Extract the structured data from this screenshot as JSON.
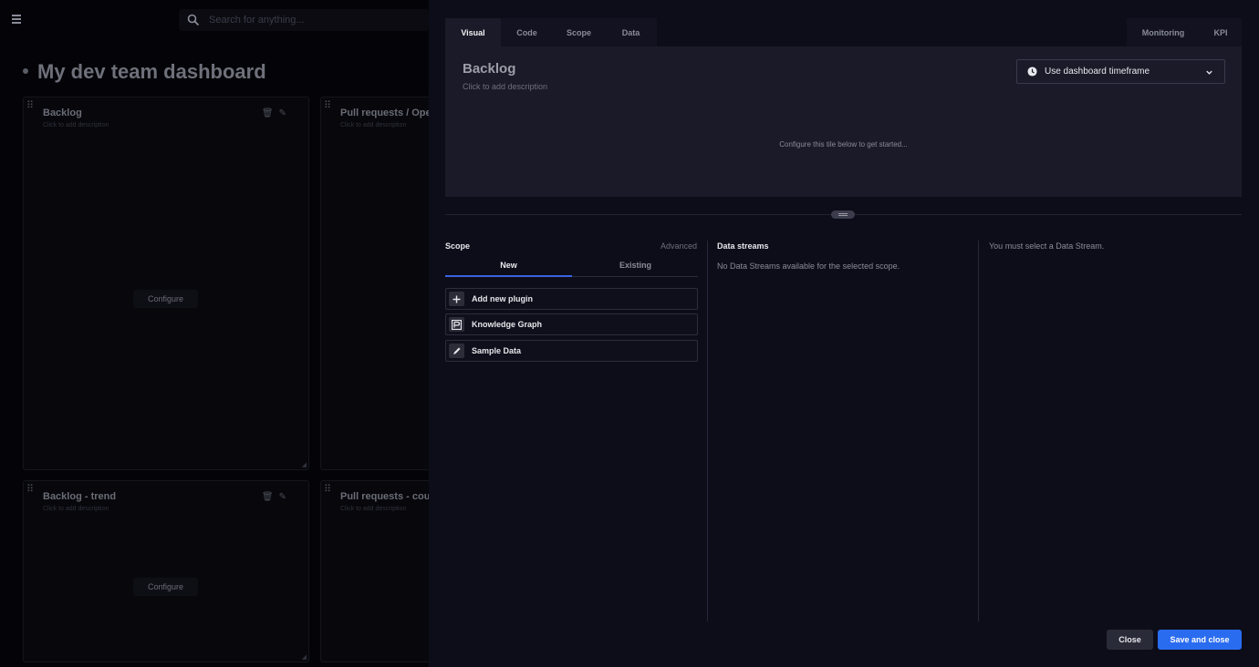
{
  "background": {
    "search_placeholder": "Search for anything...",
    "dashboard_title": "My dev team dashboard",
    "tiles": [
      {
        "title": "Backlog",
        "description": "Click to add description",
        "configure": "Configure"
      },
      {
        "title": "Pull requests / Ope",
        "description": "Click to add description"
      },
      {
        "title": "Backlog - trend",
        "description": "Click to add description",
        "configure": "Configure"
      },
      {
        "title": "Pull requests - cour",
        "description": "Click to add description"
      }
    ]
  },
  "editor": {
    "tabs": [
      "Visual",
      "Code",
      "Scope",
      "Data"
    ],
    "active_tab": "Visual",
    "right_tabs": [
      "Monitoring",
      "KPI"
    ],
    "preview": {
      "title": "Backlog",
      "description": "Click to add description",
      "message": "Configure this tile below to get started..."
    },
    "timeframe": {
      "label": "Use dashboard timeframe"
    },
    "scope": {
      "title": "Scope",
      "advanced": "Advanced",
      "subtabs": [
        "New",
        "Existing"
      ],
      "plugins": [
        {
          "label": "Add new plugin",
          "icon": "plus-icon"
        },
        {
          "label": "Knowledge Graph",
          "icon": "knowledge-graph-icon"
        },
        {
          "label": "Sample Data",
          "icon": "pencil-icon"
        }
      ]
    },
    "data_streams": {
      "title": "Data streams",
      "message": "No Data Streams available for the selected scope."
    },
    "right_message": "You must select a Data Stream.",
    "buttons": {
      "close": "Close",
      "save": "Save and close"
    },
    "colors": {
      "accent": "#2a6cf0",
      "panel": "#0d0d19",
      "preview": "#1a1a28"
    }
  }
}
